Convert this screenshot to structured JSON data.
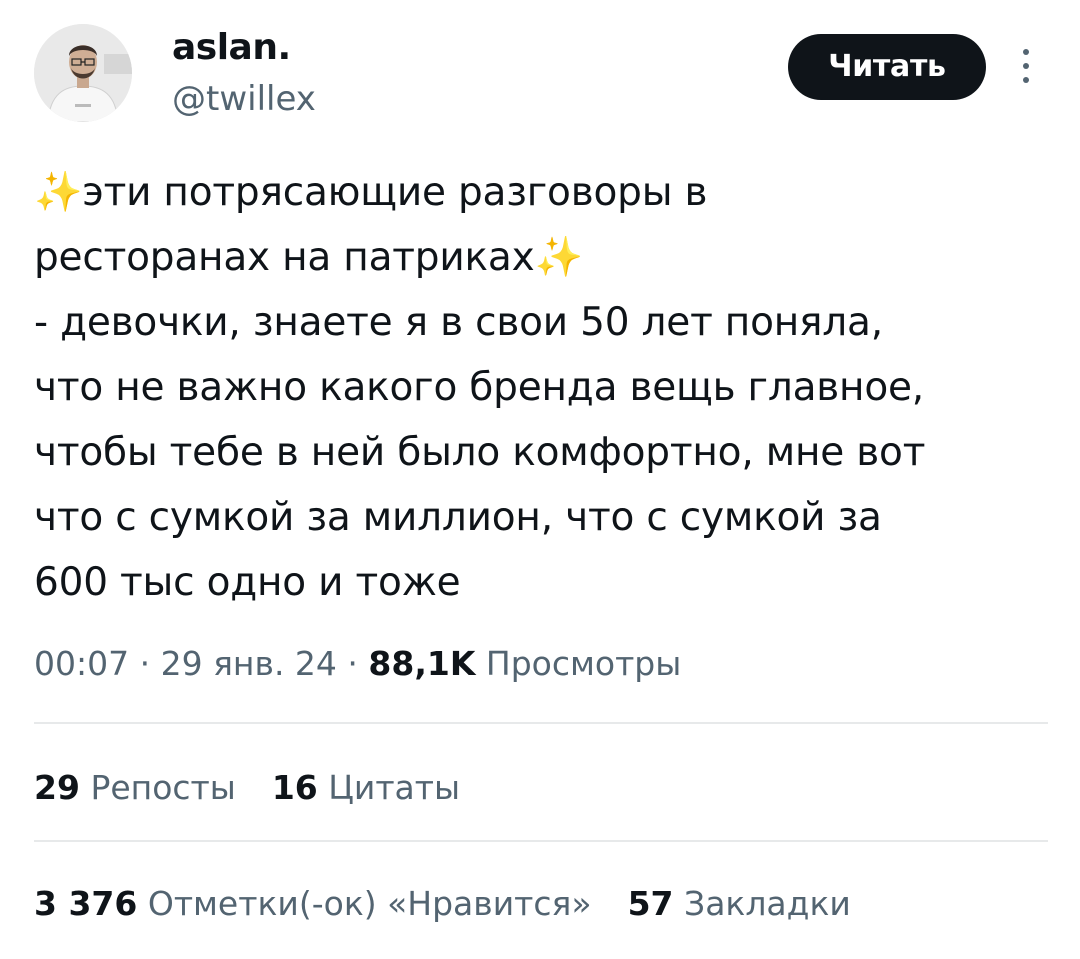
{
  "user": {
    "display_name": "aslan.",
    "handle": "@twillex",
    "avatar": "avatar-photo"
  },
  "header": {
    "follow_label": "Читать",
    "more_icon": "more-vertical-icon"
  },
  "tweet": {
    "text": "✨эти потрясающие разговоры в\nресторанах на патриках✨\n- девочки, знаете я в свои 50 лет поняла,\nчто не важно какого бренда вещь главное,\nчтобы тебе в ней было комфортно, мне вот\nчто с сумкой за миллион, что с сумкой за\n600 тыс одно и тоже"
  },
  "meta": {
    "time": "00:07",
    "separator": " · ",
    "date": "29 янв. 24",
    "views_count": "88,1K",
    "views_label": "Просмотры"
  },
  "stats_row1": [
    {
      "count": "29",
      "label": "Репосты"
    },
    {
      "count": "16",
      "label": "Цитаты"
    }
  ],
  "stats_row2": [
    {
      "count": "3 376",
      "label": "Отметки(-ок) «Нравится»"
    },
    {
      "count": "57",
      "label": "Закладки"
    }
  ],
  "colors": {
    "text": "#0f1419",
    "secondary": "#536471",
    "divider": "#e7e9ea",
    "button_bg": "#0f1419",
    "button_text": "#ffffff"
  }
}
